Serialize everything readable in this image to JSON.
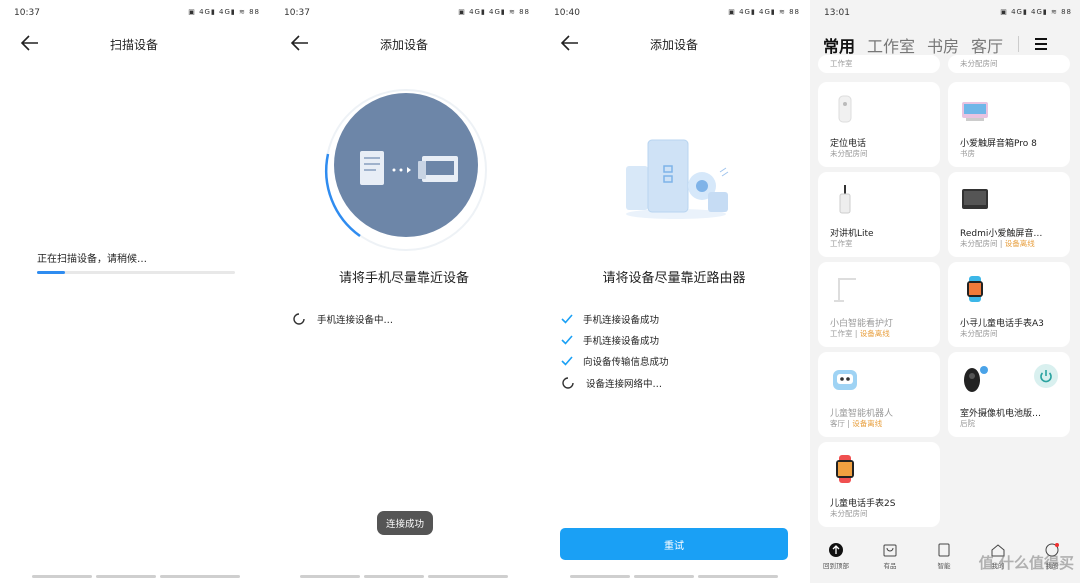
{
  "screen1": {
    "time": "10:37",
    "indicators": "▣ 4G▮ 4G▮ ≋ 88",
    "title": "扫描设备",
    "scan_text": "正在扫描设备，请稍候…",
    "progress": 0.14
  },
  "screen2": {
    "time": "10:37",
    "indicators": "▣ 4G▮ 4G▮ ≋ 88",
    "title": "添加设备",
    "hint": "请将手机尽量靠近设备",
    "step": "手机连接设备中…",
    "toast": "连接成功"
  },
  "screen3": {
    "time": "10:40",
    "indicators": "▣ 4G▮ 4G▮ ≋ 88",
    "title": "添加设备",
    "hint": "请将设备尽量靠近路由器",
    "steps": [
      "手机连接设备成功",
      "手机连接设备成功",
      "向设备传输信息成功",
      "设备连接网络中…"
    ],
    "retry": "重试"
  },
  "screen4": {
    "time": "13:01",
    "indicators": "▣ 4G▮ 4G▮ ≋ 88",
    "tabs": [
      "常用",
      "工作室",
      "书房",
      "客厅"
    ],
    "top_partial": [
      "工作室",
      "未分配房间"
    ],
    "cards": [
      {
        "name": "定位电话",
        "room": "未分配房间",
        "status": ""
      },
      {
        "name": "小爱触屏音箱Pro 8",
        "room": "书房",
        "status": ""
      },
      {
        "name": "对讲机Lite",
        "room": "工作室",
        "status": ""
      },
      {
        "name": "Redmi小爱触屏音…",
        "room": "未分配房间",
        "status": "设备离线"
      },
      {
        "name": "小白智能看护灯",
        "room": "工作室",
        "status": "设备离线"
      },
      {
        "name": "小寻儿童电话手表A3",
        "room": "未分配房间",
        "status": ""
      },
      {
        "name": "儿童智能机器人",
        "room": "客厅",
        "status": "设备离线"
      },
      {
        "name": "室外摄像机电池版…",
        "room": "后院",
        "status": ""
      },
      {
        "name": "儿童电话手表2S",
        "room": "未分配房间",
        "status": ""
      }
    ],
    "bottom_nav": [
      "回到顶部",
      "有品",
      "智能",
      "我的",
      "我的"
    ],
    "watermark": "值 什么值得买",
    "colors": {
      "offline": "#e8a040",
      "accent": "#1aa0f5"
    }
  }
}
